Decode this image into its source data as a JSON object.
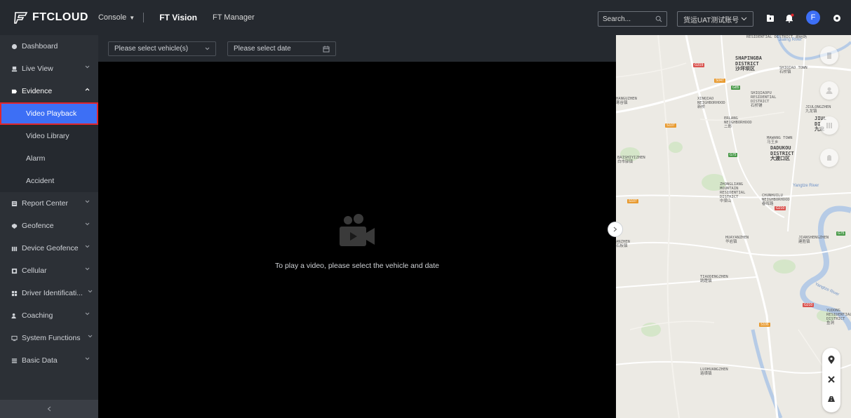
{
  "header": {
    "brand": "FTCLOUD",
    "console": "Console",
    "nav": [
      "FT Vision",
      "FT Manager"
    ],
    "search_placeholder": "Search...",
    "account": "货运UAT测试账号",
    "avatar_letter": "F"
  },
  "sidebar": {
    "items": [
      {
        "label": "Dashboard",
        "icon": "dashboard-icon"
      },
      {
        "label": "Live View",
        "icon": "live-view-icon"
      },
      {
        "label": "Evidence",
        "icon": "evidence-icon"
      },
      {
        "label": "Report Center",
        "icon": "report-icon"
      },
      {
        "label": "Geofence",
        "icon": "geofence-icon"
      },
      {
        "label": "Device Geofence",
        "icon": "device-geofence-icon"
      },
      {
        "label": "Cellular",
        "icon": "cellular-icon"
      },
      {
        "label": "Driver Identificati...",
        "icon": "driver-id-icon"
      },
      {
        "label": "Coaching",
        "icon": "coaching-icon"
      },
      {
        "label": "System Functions",
        "icon": "system-icon"
      },
      {
        "label": "Basic Data",
        "icon": "basic-data-icon"
      }
    ],
    "evidence_sub": [
      "Video Playback",
      "Video Library",
      "Alarm",
      "Accident"
    ],
    "active": "Video Playback"
  },
  "filters": {
    "vehicle_placeholder": "Please select vehicle(s)",
    "date_placeholder": "Please select date"
  },
  "player": {
    "empty_message": "To play a video, please select the vehicle and date"
  },
  "map": {
    "labels": {
      "shapingba": "SHAPINGBA\nDISTRICT\n沙坪坝区",
      "shiqiao_town": "SHIQIAO TOWN\n石桥镇",
      "hanguzhen": "HANGUZHEN\n寒谷镇",
      "xinqiao": "XINQIAO\nNEIGHBORHOOD\n新桥",
      "shiqiaopu": "SHIQIAOPU\nRESIDENTIAL\nDISTRICT\n石桥铺",
      "erlang": "ERLANG\nNEIGHBORHOOD\n二郎",
      "jiulongzhen": "JIULONGZHEN\n九龙镇",
      "mawang": "MAWANG TOWN\n马王乡",
      "dadukou": "DADUKOU\nDISTRICT\n大渡口区",
      "baishiyizhen": "BAISHIYIZHEN\n白市驿镇",
      "zhongliang": "ZHONGLIANG\nMOUNTAIN\nRESIDENTIAL\nDISTRICT\n中梁山",
      "chunhuilu": "CHUNHUILU\nNEIGHBORHOOD\n春晖路",
      "huayanzhen": "HUAYANZHEN\n华岩镇",
      "jianshengzhen": "JIANSHENGZHEN\n建胜镇",
      "tiaodengzhen": "TIAODENGZHEN\n跳蹬镇",
      "yudong": "YUDONG\nRESIDENTIAL\nDISTRICT\n鱼洞",
      "luohuangzhen": "LUOHUANGZHEN\n珞璜镇",
      "residential_top": "RESIDENTIAL\nDISTRICT\n渝碚路",
      "ganzhen": "ANZHEN\n石板镇",
      "jiuli": "JIUL\nDI\n九龙"
    },
    "rivers": [
      "Jialing River",
      "Yangtze River",
      "Yangtze River"
    ],
    "roads": [
      "G319",
      "S047",
      "G85",
      "S107",
      "G75",
      "S107",
      "G210",
      "G75",
      "G210",
      "S106"
    ]
  }
}
